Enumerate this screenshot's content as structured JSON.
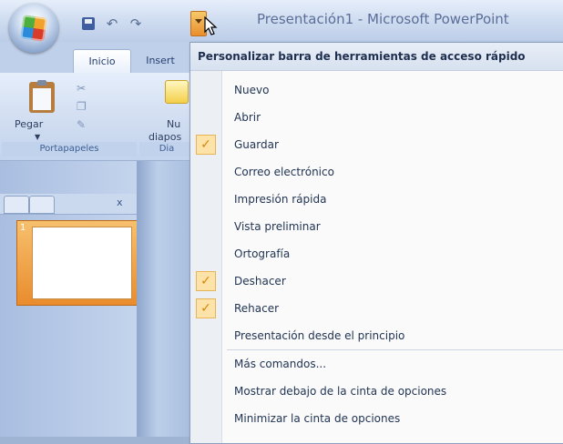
{
  "window": {
    "title": "Presentación1 - Microsoft PowerPoint"
  },
  "ribbon": {
    "tabs": [
      {
        "label": "Inicio"
      },
      {
        "label": "Insert"
      }
    ],
    "groups": {
      "portapapeles": {
        "label": "Portapapeles",
        "paste_label": "Pegar"
      },
      "diapositivas": {
        "label": "Dia",
        "new_slide_line1": "Nu",
        "new_slide_line2": "diapos"
      }
    }
  },
  "menu": {
    "title": "Personalizar barra de herramientas de acceso rápido",
    "items": [
      {
        "label": "Nuevo",
        "checked": false
      },
      {
        "label": "Abrir",
        "checked": false
      },
      {
        "label": "Guardar",
        "checked": true
      },
      {
        "label": "Correo electrónico",
        "checked": false
      },
      {
        "label": "Impresión rápida",
        "checked": false
      },
      {
        "label": "Vista preliminar",
        "checked": false
      },
      {
        "label": "Ortografía",
        "checked": false
      },
      {
        "label": "Deshacer",
        "checked": true
      },
      {
        "label": "Rehacer",
        "checked": true
      },
      {
        "label": "Presentación desde el principio",
        "checked": false
      },
      {
        "label": "Más comandos...",
        "checked": false
      },
      {
        "label": "Mostrar debajo de la cinta de opciones",
        "checked": false
      },
      {
        "label": "Minimizar la cinta de opciones",
        "checked": false
      }
    ],
    "check_glyph": "✓"
  },
  "slides_pane": {
    "slide_number": "1"
  },
  "colors": {
    "accent_orange": "#ea8f2c",
    "ribbon_blue": "#cfdcf0",
    "menu_text": "#223553"
  }
}
